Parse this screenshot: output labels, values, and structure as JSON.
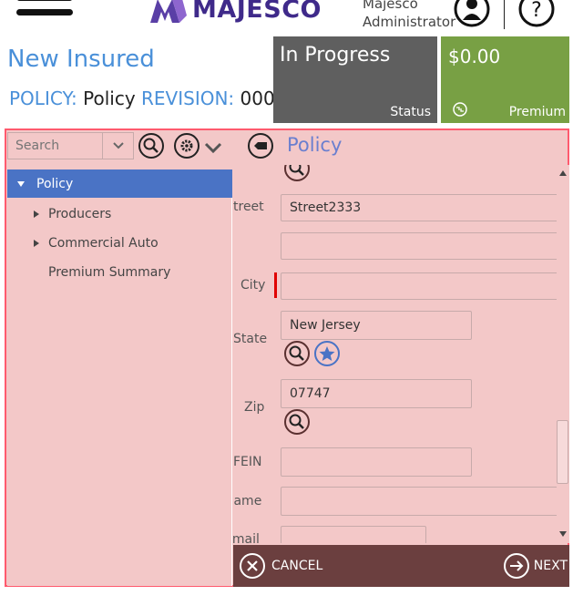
{
  "header": {
    "logo_text": "MAJESCO",
    "user_company": "Majesco",
    "user_role": "Administrator"
  },
  "page": {
    "title": "New Insured",
    "policy_label": "POLICY:",
    "policy_value": "Policy",
    "revision_label": "REVISION:",
    "revision_value": "000"
  },
  "tiles": {
    "status_value": "In Progress",
    "status_label": "Status",
    "premium_value": "$0.00",
    "premium_label": "Premium"
  },
  "toolbar": {
    "search_placeholder": "Search",
    "tree_title": "Policy"
  },
  "tree": {
    "items": [
      {
        "label": "Policy"
      },
      {
        "label": "Producers"
      },
      {
        "label": "Commercial Auto"
      },
      {
        "label": "Premium Summary"
      }
    ]
  },
  "form": {
    "street_label": "treet",
    "street_value": "Street2333",
    "street2_value": "",
    "city_label": "City",
    "city_value": "",
    "state_label": "State",
    "state_value": "New Jersey",
    "zip_label": "Zip",
    "zip_value": "07747",
    "fein_label": "FEIN",
    "fein_value": "",
    "name_label": "Name",
    "name_value": "",
    "email_label": "Email",
    "email_value": ""
  },
  "footer": {
    "cancel_label": "CANCEL",
    "next_label": "NEXT"
  },
  "colors": {
    "accent_blue": "#4a90d9",
    "status_tile": "#5f5f5f",
    "premium_tile": "#78a044",
    "panel_bg": "#f3c8c8",
    "panel_border": "#ff5a6e",
    "footer_bg": "#6b3f3f",
    "selected_item": "#4a73c5"
  }
}
